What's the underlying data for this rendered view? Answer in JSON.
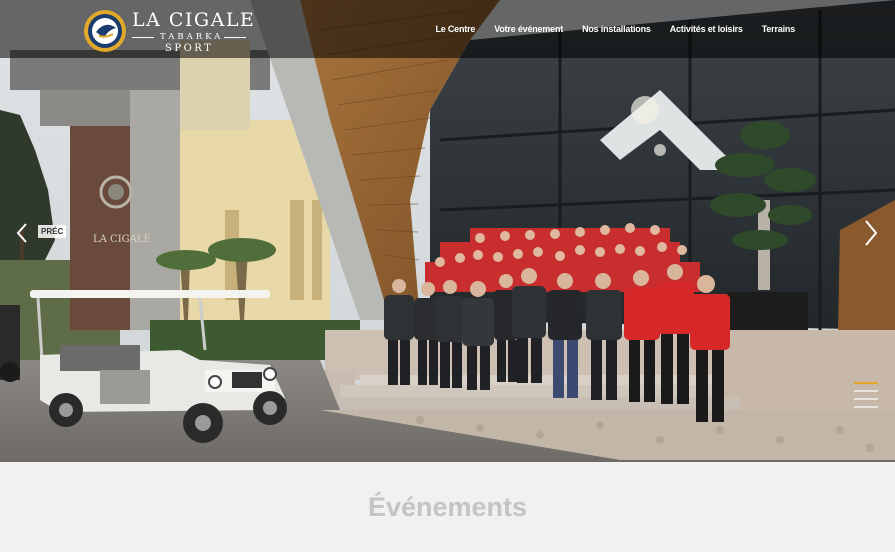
{
  "brand": {
    "title": "LA CIGALE",
    "subtitle": "TABARKA",
    "subtitle2": "SPORT"
  },
  "nav": {
    "items": [
      {
        "label": "Le Centre"
      },
      {
        "label": "Votre événement"
      },
      {
        "label": "Nos installations"
      },
      {
        "label": "Activités et loisirs"
      },
      {
        "label": "Terrains"
      }
    ]
  },
  "slider": {
    "prev_label": "PRÉC",
    "building_sign": "LA CIGALE"
  },
  "events": {
    "title": "Événements"
  },
  "colors": {
    "accent": "#e0a92a",
    "header_bg": "#000000",
    "jersey_red": "#d62828",
    "jacket_dark": "#2b2b2e"
  }
}
